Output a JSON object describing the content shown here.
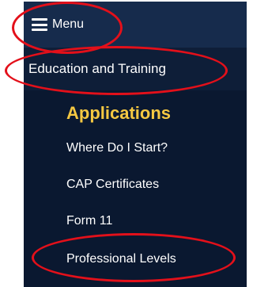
{
  "menu": {
    "label": "Menu",
    "icon": "hamburger-icon"
  },
  "section": {
    "title": "Education and Training"
  },
  "submenu": {
    "heading": "Applications",
    "items": [
      "Where Do I Start?",
      "CAP Certificates",
      "Form 11",
      "Professional Levels"
    ]
  },
  "colors": {
    "panel_background": "#0e1e38",
    "heading_accent": "#f5c842",
    "highlight_circle": "#e3101a"
  }
}
